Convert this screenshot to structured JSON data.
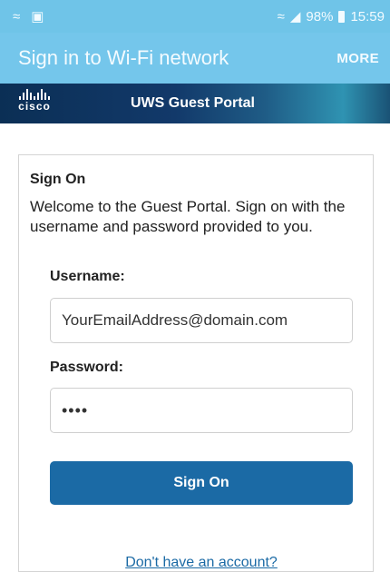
{
  "status_bar": {
    "left_icons": [
      "wifi-signal-icon",
      "image-notification-icon"
    ],
    "right_icons": [
      "wifi-icon",
      "cellular-signal-icon"
    ],
    "battery": "98%",
    "time": "15:59"
  },
  "app_bar": {
    "title": "Sign in to Wi-Fi network",
    "more_label": "MORE"
  },
  "portal": {
    "logo_text": "cisco",
    "title": "UWS Guest Portal"
  },
  "card": {
    "heading": "Sign On",
    "welcome": "Welcome to the Guest Portal. Sign on with the username and password provided to you.",
    "username_label": "Username:",
    "username_value": "YourEmailAddress@domain.com",
    "password_label": "Password:",
    "password_value": "••••",
    "signon_button": "Sign On",
    "account_link": "Don't have an account?"
  }
}
